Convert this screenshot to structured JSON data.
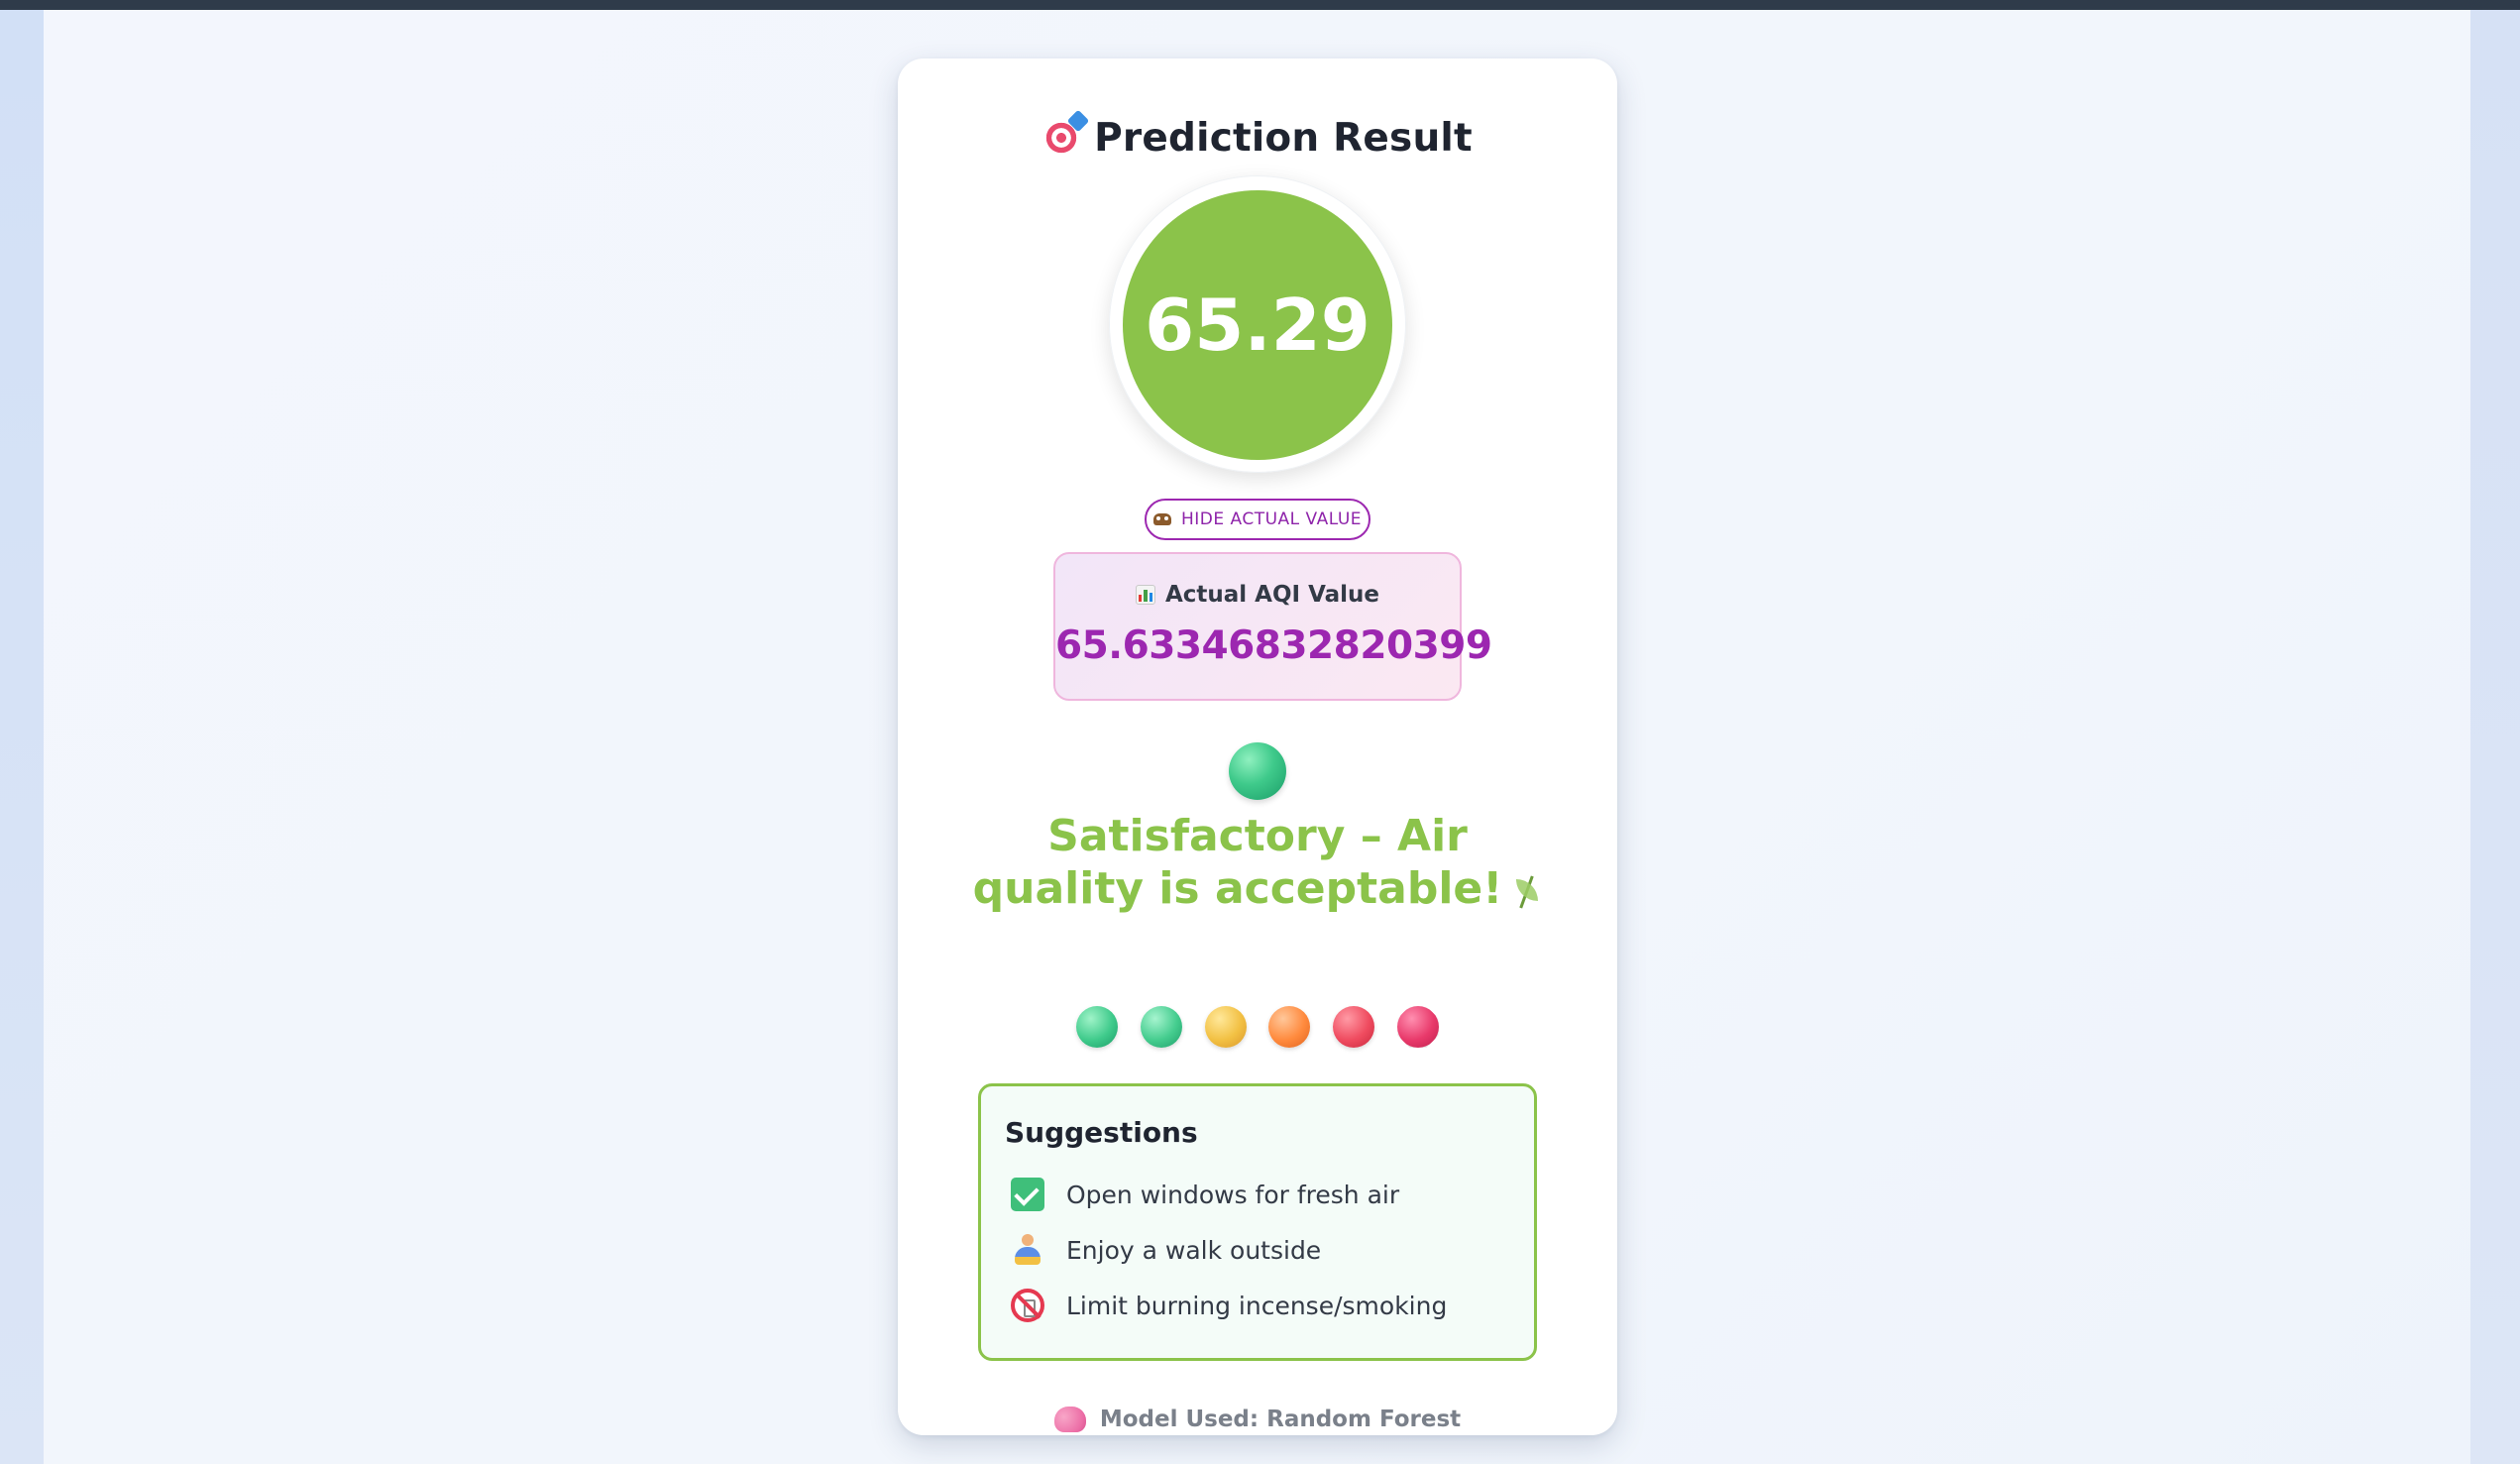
{
  "card": {
    "title": "Prediction Result",
    "title_icon": "target-icon",
    "predicted_value": "65.29",
    "predicted_color": "#8bc34a"
  },
  "toggle": {
    "label": "HIDE ACTUAL VALUE",
    "icon": "mask-icon"
  },
  "actual": {
    "label": "Actual AQI Value",
    "icon": "chart-icon",
    "value": "65.63346832820399"
  },
  "status": {
    "text": "Satisfactory – Air quality is acceptable!",
    "color": "#8bc34a",
    "icon": "leaf-icon"
  },
  "scale": {
    "levels": [
      {
        "icon": "green-orb-icon",
        "color": "#3fca8b"
      },
      {
        "icon": "green-orb-icon",
        "color": "#44cc8e"
      },
      {
        "icon": "yellow-orb-icon",
        "color": "#f2c043"
      },
      {
        "icon": "orange-orb-icon",
        "color": "#ff8a3d"
      },
      {
        "icon": "red-orb-icon",
        "color": "#ef4b5f"
      },
      {
        "icon": "stop-sign-icon",
        "color": "#e8396a"
      }
    ]
  },
  "suggestions": {
    "title": "Suggestions",
    "items": [
      {
        "icon": "check-icon",
        "text": "Open windows for fresh air"
      },
      {
        "icon": "walking-person-icon",
        "text": "Enjoy a walk outside"
      },
      {
        "icon": "no-smoking-icon",
        "text": "Limit burning incense/smoking"
      }
    ]
  },
  "footer": {
    "text": "Model Used: Random Forest",
    "icon": "brain-icon"
  }
}
